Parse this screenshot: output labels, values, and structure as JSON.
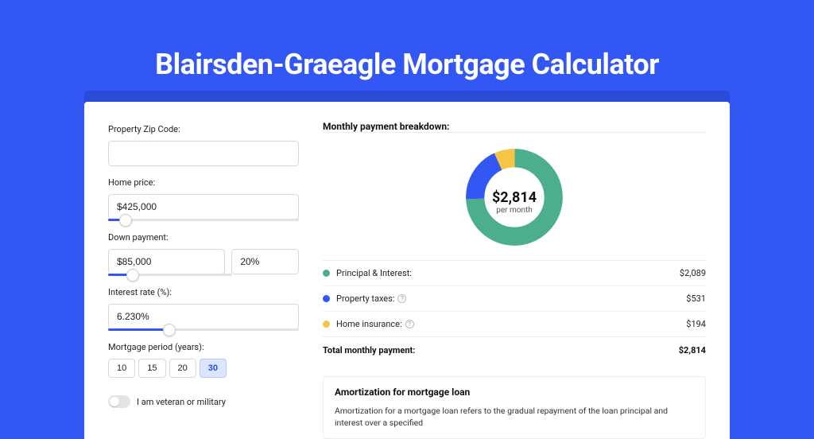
{
  "page_title": "Blairsden-Graeagle Mortgage Calculator",
  "form": {
    "zip_label": "Property Zip Code:",
    "zip_value": "",
    "home_price_label": "Home price:",
    "home_price_value": "$425,000",
    "home_price_slider_pct": 9,
    "down_payment_label": "Down payment:",
    "down_payment_value": "$85,000",
    "down_payment_pct_value": "20%",
    "down_payment_slider_pct": 20,
    "interest_label": "Interest rate (%):",
    "interest_value": "6.230%",
    "interest_slider_pct": 32,
    "period_label": "Mortgage period (years):",
    "period_options": [
      "10",
      "15",
      "20",
      "30"
    ],
    "period_selected": "30",
    "veteran_label": "I am veteran or military",
    "veteran_on": false
  },
  "breakdown": {
    "title": "Monthly payment breakdown:",
    "total_value": "$2,814",
    "total_sub": "per month",
    "items": [
      {
        "label": "Principal & Interest:",
        "value": "$2,089",
        "color": "#4cae8a",
        "info": false
      },
      {
        "label": "Property taxes:",
        "value": "$531",
        "color": "#3257f5",
        "info": true
      },
      {
        "label": "Home insurance:",
        "value": "$194",
        "color": "#f5c544",
        "info": true
      }
    ],
    "total_label": "Total monthly payment:",
    "total_display": "$2,814"
  },
  "chart_data": {
    "type": "pie",
    "title": "Monthly payment breakdown",
    "categories": [
      "Principal & Interest",
      "Property taxes",
      "Home insurance"
    ],
    "values": [
      2089,
      531,
      194
    ],
    "colors": [
      "#4cae8a",
      "#3257f5",
      "#f5c544"
    ],
    "center_value": "$2,814",
    "center_sub": "per month"
  },
  "amortization": {
    "title": "Amortization for mortgage loan",
    "body": "Amortization for a mortgage loan refers to the gradual repayment of the loan principal and interest over a specified"
  }
}
